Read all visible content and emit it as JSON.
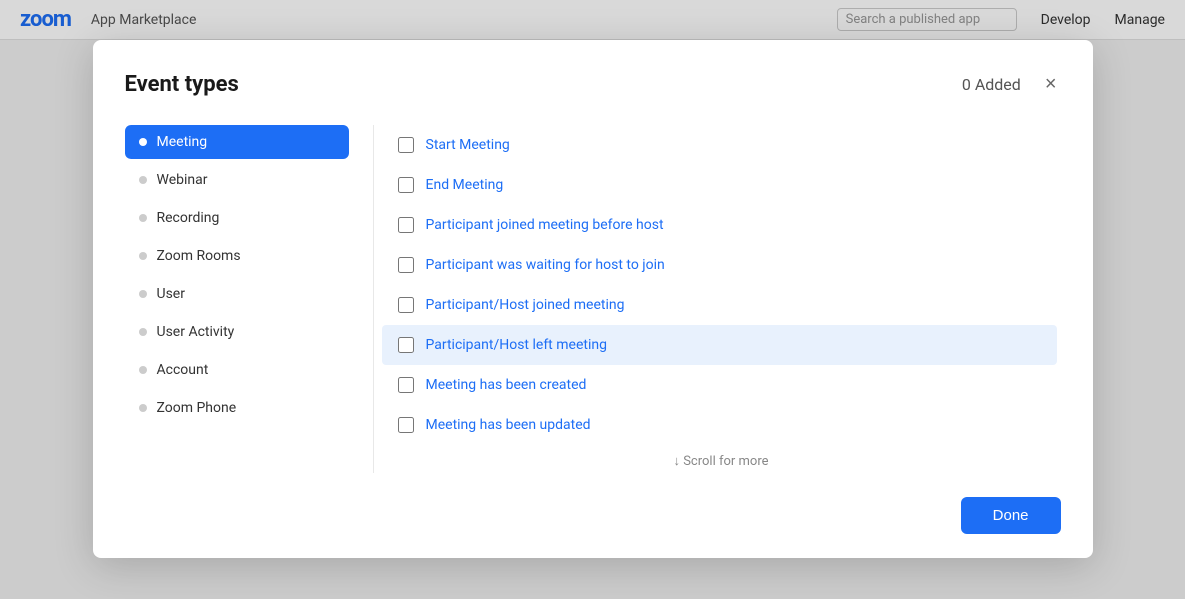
{
  "nav": {
    "logo": "zoom",
    "title": "App Marketplace",
    "search_placeholder": "Search a published app",
    "develop_label": "Develop",
    "manage_label": "Manage"
  },
  "modal": {
    "title": "Event types",
    "added_count": "0 Added",
    "close_icon": "×",
    "sidebar": {
      "items": [
        {
          "label": "Meeting",
          "active": true
        },
        {
          "label": "Webinar",
          "active": false
        },
        {
          "label": "Recording",
          "active": false
        },
        {
          "label": "Zoom Rooms",
          "active": false
        },
        {
          "label": "User",
          "active": false
        },
        {
          "label": "User Activity",
          "active": false
        },
        {
          "label": "Account",
          "active": false
        },
        {
          "label": "Zoom Phone",
          "active": false
        }
      ]
    },
    "events": [
      {
        "label": "Start Meeting",
        "checked": false,
        "highlighted": false
      },
      {
        "label": "End Meeting",
        "checked": false,
        "highlighted": false
      },
      {
        "label": "Participant joined meeting before host",
        "checked": false,
        "highlighted": false
      },
      {
        "label": "Participant was waiting for host to join",
        "checked": false,
        "highlighted": false
      },
      {
        "label": "Participant/Host joined meeting",
        "checked": false,
        "highlighted": false
      },
      {
        "label": "Participant/Host left meeting",
        "checked": false,
        "highlighted": true
      },
      {
        "label": "Meeting has been created",
        "checked": false,
        "highlighted": false
      },
      {
        "label": "Meeting has been updated",
        "checked": false,
        "highlighted": false
      }
    ],
    "scroll_more": "↓ Scroll for more",
    "done_label": "Done"
  }
}
